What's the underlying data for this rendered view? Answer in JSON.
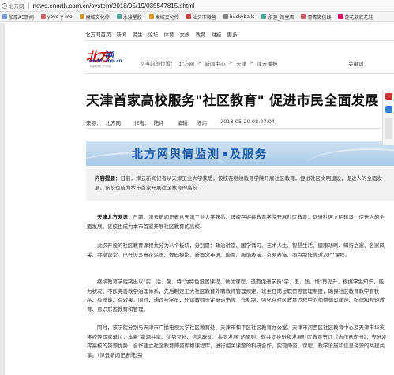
{
  "browser": {
    "site_label": "北方网",
    "url": "news.enorth.com.cn/system/2018/05/19/035547815.shtml",
    "bookmarks": [
      "加厚A3新闻",
      "yoyo-y-mo",
      "魔域文化传",
      "永骏塑胶",
      "魔域文化传",
      "汕头市微营",
      "buckyballs",
      "永骏_淘宝店",
      "青青微信践",
      "莲花软底花鞋"
    ]
  },
  "site_nav": {
    "items": [
      "北方网首页",
      "新闻",
      "民生",
      "论坛",
      "体育",
      "文娱",
      "教育",
      "财经",
      "更多"
    ]
  },
  "logo": {
    "name_cn": "北方",
    "name_cn2": "网",
    "domain": "enorth.com.cn",
    "tagline": "天津新闻门户网站"
  },
  "breadcrumb": {
    "prefix": "您当前的位置：",
    "items": [
      "北方网",
      "新闻中心",
      "天津",
      "津云播报"
    ]
  },
  "keywords_label": "关键词",
  "article": {
    "title": "天津首家高校服务\"社区教育\" 促进市民全面发展",
    "source_label": "来源：",
    "source": "北方网",
    "editor_label": "作者：",
    "editor": "陆炜",
    "author_label": "编辑：",
    "author": "陆炜",
    "datetime": "2018-05-20 08:27:04"
  },
  "banner": {
    "text_left": "北方网舆情监测",
    "text_right": "及服务"
  },
  "summary": {
    "label": "内容提要：",
    "text": "日前，津云新闻记者从天津工业大学获悉，该校在继续教育学院开展社区教育，促进社区文明建设，促进人的全面发展。该校也成为本市首家开展社区教育的高校……"
  },
  "paragraphs": [
    {
      "source": "天津北方网讯：",
      "text": "日前，津云新闻记者从天津工业大学获悉，该校在继续教育学院开展社区教育，促进社区文明建设，促进人的全面发展。该校也成为本市首家开展社区教育的高校。"
    },
    {
      "source": "",
      "text": "此次开设的社区教育课程共分为八个板块，分别是：政治讲堂、国学诵习、艺术人生、智慧生活、健康功略、知行之家、名家风采、共享课堂。已开设写意花鸟画、数码摄影、新概念英语、瑜伽、服饰表演、京剧表演、面点制作等近20个课程。"
    },
    {
      "source": "",
      "text": "继续教育学院突出以\"实、活、强、特\"为特色设置课程，做优课程，道而促进学员\"学、思、践、悟\"再提升，根据学生知识，能力状况，不断完善教学治理体系，先后制定工大社区教育外聘教师管理规定，班主任岗位职责等管理制度，确保社区教育教学有秩序、有质量、有效果。同时，通过与学员，任课教师签定承诺书等工作机制，强化在社区教育过程中的师德师风建设、纪律和规矩教育、意识形态教育和管理。"
    },
    {
      "source": "",
      "text": "同时，该学院分别与天津市广播电视大学社区教育处、天津市和平区社区教育办公室、天津市河西区社区教育中心及天津市华英学校等四家单位，本着\"资源共享、优势互补、信息联动、共同发展\"的原则，就共同推进和发展社区教育签订《合作意向书》，充分发挥高校的资源优势，合作建立社区教育师资库和课程库，进行相关课题的科研合作，实现师资、课程、教学设施和信息资源的共建共享。（津云新闻记者陆炜）"
    }
  ]
}
